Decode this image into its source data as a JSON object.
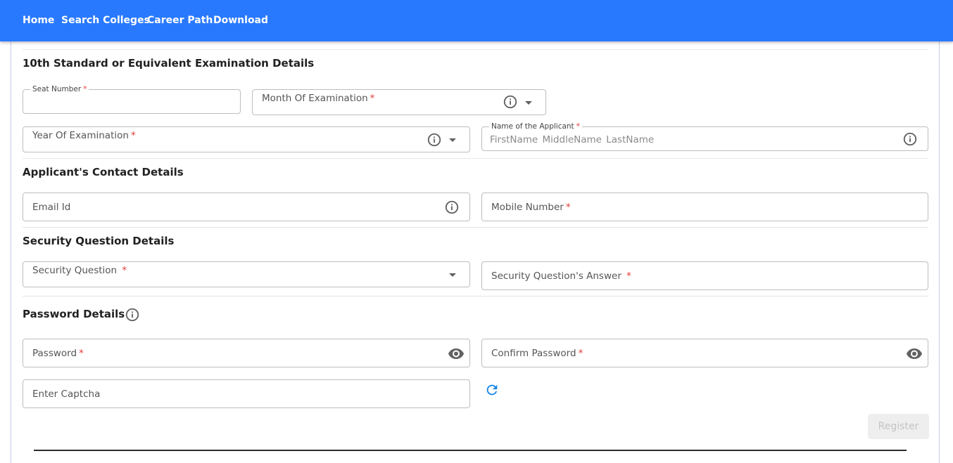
{
  "nav": {
    "items": [
      {
        "label": "Home"
      },
      {
        "label": "Search Colleges"
      },
      {
        "label": "Career Path"
      },
      {
        "label": "Download"
      }
    ]
  },
  "sections": {
    "exam": "10th Standard or Equivalent Examination Details",
    "contact": "Applicant's Contact Details",
    "security": "Security Question Details",
    "password": "Password Details"
  },
  "fields": {
    "seat_number": {
      "label": "Seat Number",
      "required": "*",
      "value": ""
    },
    "month_of_examination": {
      "label": "Month Of Examination",
      "required": "*",
      "value": ""
    },
    "year_of_examination": {
      "label": "Year Of Examination",
      "required": "*",
      "value": ""
    },
    "applicant_name": {
      "label": "Name of the Applicant",
      "required": "*",
      "placeholder": "FirstName  MiddleName  LastName"
    },
    "email": {
      "label": "Email Id",
      "value": ""
    },
    "mobile": {
      "label": "Mobile Number",
      "required": "*",
      "value": ""
    },
    "security_question": {
      "label": "Security Question ",
      "required": "*",
      "value": ""
    },
    "security_answer": {
      "label": "Security Question's Answer ",
      "required": "*",
      "value": ""
    },
    "password": {
      "label": "Password",
      "required": "*",
      "value": ""
    },
    "confirm_password": {
      "label": "Confirm Password",
      "required": "*",
      "value": ""
    },
    "captcha": {
      "label": "Enter Captcha",
      "value": ""
    }
  },
  "actions": {
    "register_label": "Register",
    "register_enabled": false
  },
  "colors": {
    "brand": "#2979ff",
    "required": "#e53935",
    "refresh": "#1e88e5"
  },
  "icons": [
    "info-icon",
    "chevron-down-icon",
    "eye-icon",
    "refresh-icon"
  ]
}
